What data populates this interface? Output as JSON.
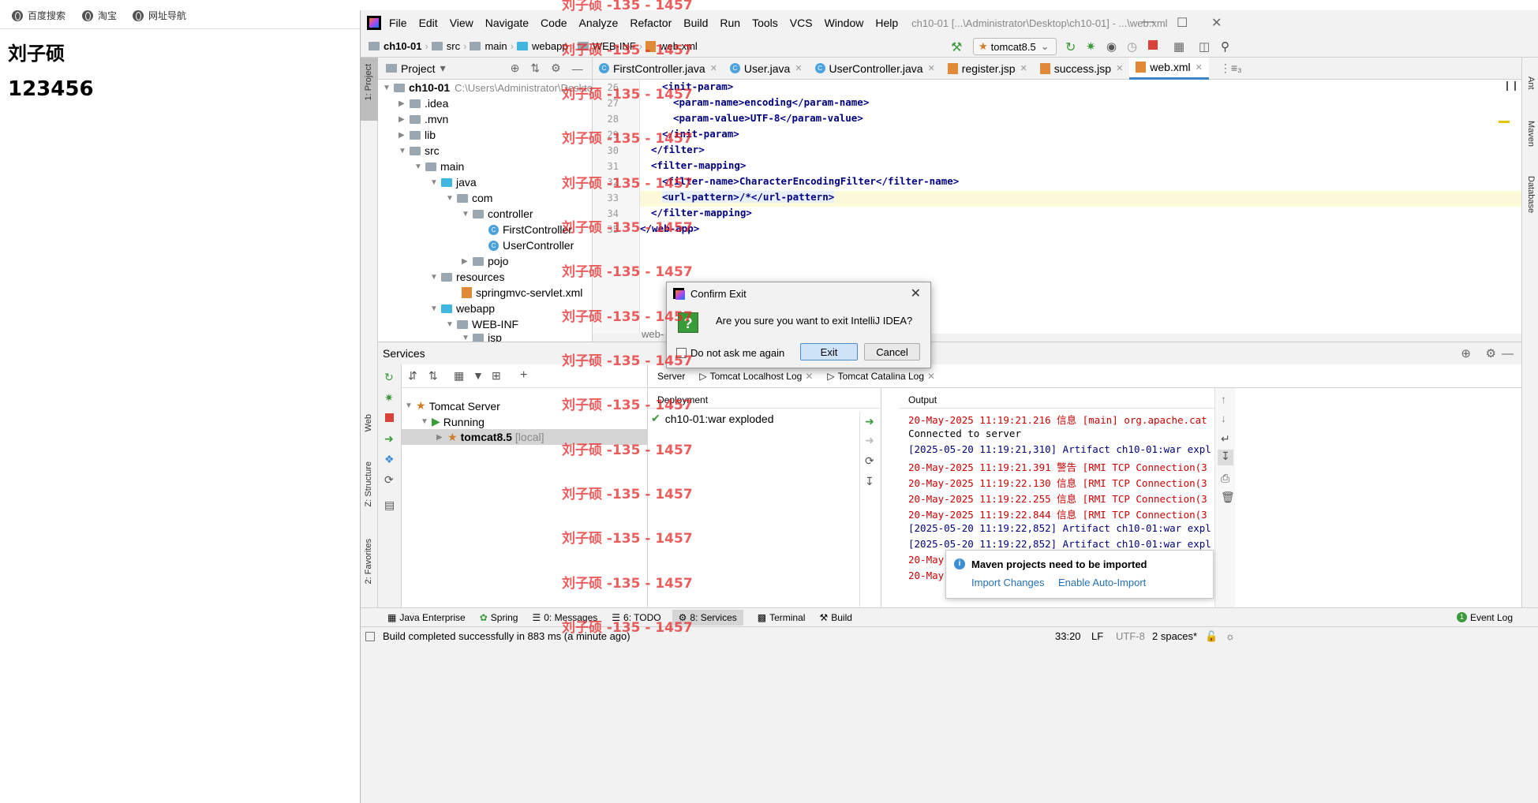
{
  "browser": {
    "bookmarks": [
      {
        "label": "百度搜索",
        "icon": "globe-icon"
      },
      {
        "label": "淘宝",
        "icon": "globe-icon"
      },
      {
        "label": "网址导航",
        "icon": "globe-icon"
      }
    ],
    "page_name": "刘子硕",
    "page_value": "123456"
  },
  "ide": {
    "menu": [
      "File",
      "Edit",
      "View",
      "Navigate",
      "Code",
      "Analyze",
      "Refactor",
      "Build",
      "Run",
      "Tools",
      "VCS",
      "Window",
      "Help"
    ],
    "window_title": "ch10-01 [...\\Administrator\\Desktop\\ch10-01] - ...\\web.xml",
    "breadcrumb": [
      "ch10-01",
      "src",
      "main",
      "webapp",
      "WEB-INF",
      "web.xml"
    ],
    "run_config": "tomcat8.5",
    "project": {
      "header": "Project",
      "root": "ch10-01",
      "root_path": "C:\\Users\\Administrator\\Deskto",
      "items": [
        ".idea",
        ".mvn",
        "lib",
        "src",
        "main",
        "java",
        "com",
        "controller",
        "FirstController",
        "UserController",
        "pojo",
        "resources",
        "springmvc-servlet.xml",
        "webapp",
        "WEB-INF",
        "jsp"
      ]
    },
    "left_tabs": [
      "1: Project",
      "Web",
      "Z: Structure",
      "2: Favorites"
    ],
    "right_tabs": [
      "Ant",
      "Maven",
      "Database"
    ],
    "editor_tabs": [
      {
        "label": "FirstController.java",
        "active": false
      },
      {
        "label": "User.java",
        "active": false
      },
      {
        "label": "UserController.java",
        "active": false
      },
      {
        "label": "register.jsp",
        "active": false
      },
      {
        "label": "success.jsp",
        "active": false
      },
      {
        "label": "web.xml",
        "active": true
      }
    ],
    "tab_overflow": "⋮≡₃",
    "code_lines": [
      {
        "n": "26",
        "text": "<init-param>"
      },
      {
        "n": "27",
        "text": "<param-name>encoding</param-name>"
      },
      {
        "n": "28",
        "text": "<param-value>UTF-8</param-value>"
      },
      {
        "n": "29",
        "text": "</init-param>"
      },
      {
        "n": "30",
        "text": "</filter>"
      },
      {
        "n": "31",
        "text": "<filter-mapping>"
      },
      {
        "n": "32",
        "text": "<filter-name>CharacterEncodingFilter</filter-name>"
      },
      {
        "n": "33",
        "text": "<url-pattern>/*</url-pattern>"
      },
      {
        "n": "34",
        "text": "</filter-mapping>"
      },
      {
        "n": "35",
        "text": "</web-app>"
      }
    ],
    "editor_breadcrumb": "web-",
    "services": {
      "header": "Services",
      "tree": [
        "Tomcat Server",
        "Running",
        "tomcat8.5"
      ],
      "tree_suffix": "[local]",
      "detail_tabs": [
        "Server",
        "Tomcat Localhost Log",
        "Tomcat Catalina Log"
      ],
      "deployment_header": "Deployment",
      "deployment_item": "ch10-01:war exploded",
      "output_header": "Output",
      "output_lines": [
        "20-May-2025 11:19:21.216 信息 [main] org.apache.cat",
        "Connected to server",
        "[2025-05-20 11:19:21,310] Artifact ch10-01:war expl",
        "20-May-2025 11:19:21.391 警告 [RMI TCP Connection(3",
        "20-May-2025 11:19:22.130 信息 [RMI TCP Connection(3",
        "20-May-2025 11:19:22.255 信息 [RMI TCP Connection(3",
        "20-May-2025 11:19:22.844 信息 [RMI TCP Connection(3",
        "[2025-05-20 11:19:22,852] Artifact ch10-01:war expl",
        "[2025-05-20 11:19:22,852] Artifact ch10-01:war expl",
        "20-May-",
        "20-May-"
      ]
    },
    "bottom_tools": [
      "Java Enterprise",
      "Spring",
      "0: Messages",
      "6: TODO",
      "8: Services",
      "Terminal",
      "Build"
    ],
    "event_log": "Event Log",
    "status_text": "Build completed successfully in 883 ms (a minute ago)",
    "status_right": {
      "position": "33:20",
      "line_sep": "LF",
      "encoding": "UTF-8",
      "indent": "2 spaces*"
    },
    "notification": {
      "title": "Maven projects need to be imported",
      "link1": "Import Changes",
      "link2": "Enable Auto-Import"
    }
  },
  "dialog": {
    "title": "Confirm Exit",
    "message": "Are you sure you want to exit IntelliJ IDEA?",
    "checkbox": "Do not ask me again",
    "exit": "Exit",
    "cancel": "Cancel"
  },
  "watermark": "刘子硕 -135 - 1457",
  "colors": {
    "accent": "#4083c9",
    "tag": "#000080",
    "error": "#c00000",
    "watermark": "#e62828"
  }
}
